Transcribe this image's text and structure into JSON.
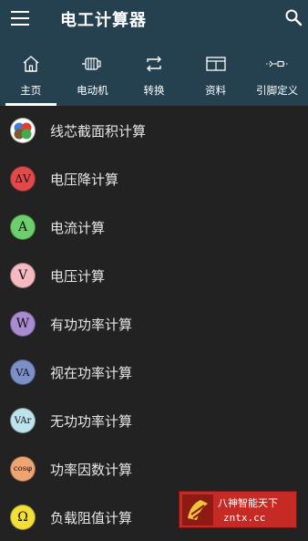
{
  "app": {
    "title": "电工计算器"
  },
  "tabs": [
    {
      "label": "主页",
      "icon": "home-icon",
      "active": true
    },
    {
      "label": "电动机",
      "icon": "motor-icon",
      "active": false
    },
    {
      "label": "转换",
      "icon": "convert-icon",
      "active": false
    },
    {
      "label": "资料",
      "icon": "book-icon",
      "active": false
    },
    {
      "label": "引脚定义",
      "icon": "pinout-icon",
      "active": false
    }
  ],
  "list": [
    {
      "label": "线芯截面积计算",
      "icon_text": "",
      "icon_color": "#ffffff",
      "icon": "wire-cross-section-icon"
    },
    {
      "label": "电压降计算",
      "icon_text": "ΔV",
      "icon_color": "#e04a4a",
      "icon": "voltage-drop-icon"
    },
    {
      "label": "电流计算",
      "icon_text": "A",
      "icon_color": "#6ccf6c",
      "icon": "current-icon"
    },
    {
      "label": "电压计算",
      "icon_text": "V",
      "icon_color": "#f5b9c2",
      "icon": "voltage-icon"
    },
    {
      "label": "有功功率计算",
      "icon_text": "W",
      "icon_color": "#a98bd0",
      "icon": "active-power-icon"
    },
    {
      "label": "视在功率计算",
      "icon_text": "VA",
      "icon_color": "#7c8fc9",
      "icon": "apparent-power-icon"
    },
    {
      "label": "无功功率计算",
      "icon_text": "VAr",
      "icon_color": "#bfe3ec",
      "icon": "reactive-power-icon"
    },
    {
      "label": "功率因数计算",
      "icon_text": "cosφ",
      "icon_color": "#f0a472",
      "icon": "power-factor-icon"
    },
    {
      "label": "负载阻值计算",
      "icon_text": "Ω",
      "icon_color": "#f3df3a",
      "icon": "resistance-icon"
    }
  ],
  "watermark": {
    "line1": "八神智能天下",
    "line2": "zntx.cc"
  }
}
